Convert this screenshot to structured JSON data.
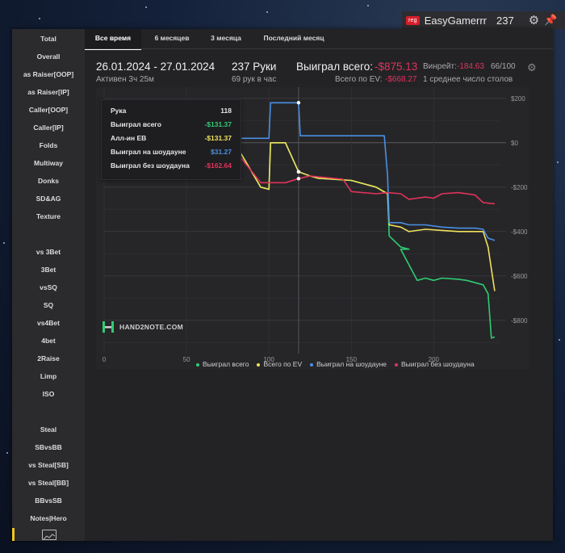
{
  "user": {
    "room_badge": "reg",
    "nickname": "EasyGamerrr",
    "count": "237"
  },
  "sidebar": {
    "items": [
      "Total",
      "Overall",
      "as Raiser[OOP]",
      "as Raiser[IP]",
      "Caller[OOP]",
      "Caller[IP]",
      "Folds",
      "Multiway",
      "Donks",
      "SD&AG",
      "Texture",
      "vs 3Bet",
      "3Bet",
      "vsSQ",
      "SQ",
      "vs4Bet",
      "4bet",
      "2Raise",
      "Limp",
      "ISO",
      "Steal",
      "SBvsBB",
      "vs Steal[SB]",
      "vs Steal[BB]",
      "BBvsSB",
      "Notes|Hero"
    ]
  },
  "tabs": [
    "Все время",
    "6 месяцев",
    "3 месяца",
    "Последний месяц"
  ],
  "summary": {
    "date_range": "26.01.2024 - 27.01.2024",
    "active": "Активен 3ч 25м",
    "hands": "237 Руки",
    "hands_per_hour": "69 рук в час",
    "won_label": "Выиграл всего:",
    "won_value": "-$875.13",
    "ev_label": "Всего по EV:",
    "ev_value": "-$668.27",
    "winrate_label": "Винрейт:",
    "winrate_value": "-184.63",
    "winrate_unit": "66/100",
    "tables": "1 среднее число столов"
  },
  "tooltip": {
    "rows": [
      {
        "label": "Рука",
        "value": "118",
        "color": "#e6e6e6"
      },
      {
        "label": "Выиграл всего",
        "value": "-$131.37",
        "color": "#2ecc71"
      },
      {
        "label": "Алл-ин ЕВ",
        "value": "-$131.37",
        "color": "#f1e15b"
      },
      {
        "label": "Выиграл на шоудауне",
        "value": "$31.27",
        "color": "#4a90e2"
      },
      {
        "label": "Выиграл без шоудауна",
        "value": "-$162.64",
        "color": "#e0335a"
      }
    ]
  },
  "logo": {
    "text": "HAND2NOTE.COM"
  },
  "colors": {
    "won": "#2ecc71",
    "ev": "#f1e15b",
    "sd": "#4a90e2",
    "nsd": "#e0335a",
    "badge": "#d81e2a",
    "accent": "#f1c61a"
  },
  "chart_data": {
    "type": "line",
    "xlim": [
      0,
      240
    ],
    "ylim": [
      -950,
      250
    ],
    "x_ticks": [
      0,
      50,
      100,
      150,
      200
    ],
    "y_ticks": [
      200,
      0,
      -200,
      -400,
      -600,
      -800
    ],
    "y_tick_labels": [
      "$200",
      "$0",
      "-$200",
      "-$400",
      "-$600",
      "-$800"
    ],
    "series": [
      {
        "name": "Выиграл всего",
        "color": "#2ecc71",
        "points": [
          [
            0,
            0
          ],
          [
            40,
            0
          ],
          [
            80,
            -10
          ],
          [
            95,
            -200
          ],
          [
            100,
            -210
          ],
          [
            101,
            0
          ],
          [
            110,
            0
          ],
          [
            118,
            -131
          ],
          [
            125,
            -150
          ],
          [
            130,
            -160
          ],
          [
            150,
            -170
          ],
          [
            165,
            -200
          ],
          [
            172,
            -230
          ],
          [
            173,
            -420
          ],
          [
            180,
            -470
          ],
          [
            185,
            -480
          ],
          [
            180,
            -480
          ],
          [
            190,
            -620
          ],
          [
            195,
            -610
          ],
          [
            200,
            -620
          ],
          [
            205,
            -610
          ],
          [
            215,
            -615
          ],
          [
            220,
            -620
          ],
          [
            230,
            -640
          ],
          [
            233,
            -680
          ],
          [
            235,
            -880
          ],
          [
            237,
            -875
          ]
        ]
      },
      {
        "name": "Всего по EV",
        "color": "#f1e15b",
        "points": [
          [
            0,
            0
          ],
          [
            40,
            0
          ],
          [
            80,
            -10
          ],
          [
            95,
            -200
          ],
          [
            100,
            -210
          ],
          [
            101,
            0
          ],
          [
            110,
            0
          ],
          [
            118,
            -131
          ],
          [
            125,
            -150
          ],
          [
            130,
            -160
          ],
          [
            150,
            -170
          ],
          [
            165,
            -200
          ],
          [
            172,
            -230
          ],
          [
            173,
            -370
          ],
          [
            180,
            -380
          ],
          [
            185,
            -400
          ],
          [
            195,
            -390
          ],
          [
            205,
            -395
          ],
          [
            215,
            -400
          ],
          [
            225,
            -400
          ],
          [
            230,
            -400
          ],
          [
            233,
            -470
          ],
          [
            237,
            -668
          ]
        ]
      },
      {
        "name": "Выиграл на шоудауне",
        "color": "#4a90e2",
        "points": [
          [
            0,
            20
          ],
          [
            50,
            20
          ],
          [
            100,
            20
          ],
          [
            101,
            180
          ],
          [
            105,
            180
          ],
          [
            118,
            180
          ],
          [
            119,
            31
          ],
          [
            170,
            31
          ],
          [
            172,
            -150
          ],
          [
            173,
            -360
          ],
          [
            180,
            -360
          ],
          [
            185,
            -370
          ],
          [
            195,
            -370
          ],
          [
            205,
            -380
          ],
          [
            215,
            -385
          ],
          [
            225,
            -385
          ],
          [
            230,
            -390
          ],
          [
            233,
            -430
          ],
          [
            237,
            -440
          ]
        ]
      },
      {
        "name": "Выиграл без шоудауна",
        "color": "#e0335a",
        "points": [
          [
            0,
            -20
          ],
          [
            40,
            -20
          ],
          [
            80,
            -40
          ],
          [
            95,
            -180
          ],
          [
            110,
            -180
          ],
          [
            118,
            -162
          ],
          [
            125,
            -150
          ],
          [
            145,
            -165
          ],
          [
            150,
            -220
          ],
          [
            165,
            -230
          ],
          [
            172,
            -225
          ],
          [
            180,
            -230
          ],
          [
            185,
            -255
          ],
          [
            195,
            -245
          ],
          [
            200,
            -250
          ],
          [
            205,
            -230
          ],
          [
            215,
            -225
          ],
          [
            225,
            -235
          ],
          [
            230,
            -270
          ],
          [
            237,
            -275
          ]
        ]
      }
    ],
    "marker_x": 118,
    "legend": "bottom"
  }
}
